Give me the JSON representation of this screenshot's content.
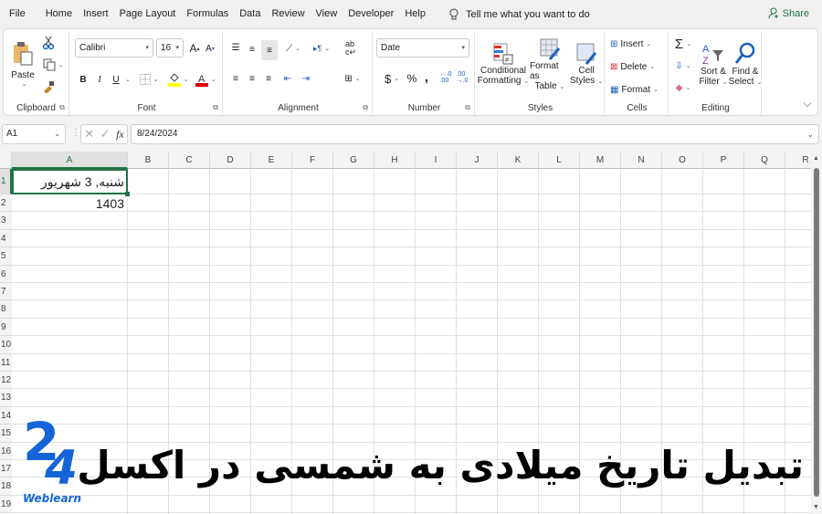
{
  "menubar": {
    "tabs": [
      "File",
      "Home",
      "Insert",
      "Page Layout",
      "Formulas",
      "Data",
      "Review",
      "View",
      "Developer",
      "Help"
    ],
    "active_tab": "Home",
    "tell_me": "Tell me what you want to do",
    "share": "Share"
  },
  "ribbon": {
    "clipboard": {
      "label": "Clipboard",
      "paste": "Paste"
    },
    "font": {
      "label": "Font",
      "name": "Calibri",
      "size": "16",
      "bold": "B",
      "italic": "I",
      "underline": "U",
      "fill_color": "#ffff00",
      "font_color": "#e00000"
    },
    "alignment": {
      "label": "Alignment"
    },
    "number": {
      "label": "Number",
      "format": "Date",
      "currency": "$",
      "percent": "%",
      "comma": ","
    },
    "styles": {
      "label": "Styles",
      "conditional": [
        "Conditional",
        "Formatting"
      ],
      "format_table": [
        "Format as",
        "Table"
      ],
      "cell_styles": [
        "Cell",
        "Styles"
      ]
    },
    "cells": {
      "label": "Cells",
      "insert": "Insert",
      "delete": "Delete",
      "format": "Format"
    },
    "editing": {
      "label": "Editing",
      "sort": [
        "Sort &",
        "Filter"
      ],
      "find": [
        "Find &",
        "Select"
      ]
    }
  },
  "formula_bar": {
    "name_box": "A1",
    "value": "8/24/2024",
    "fx": "fx"
  },
  "sheet": {
    "columns": [
      "A",
      "B",
      "C",
      "D",
      "E",
      "F",
      "G",
      "H",
      "I",
      "J",
      "K",
      "L",
      "M",
      "N",
      "O",
      "P",
      "Q",
      "R"
    ],
    "rows": [
      "1",
      "2",
      "3",
      "4",
      "5",
      "6",
      "7",
      "8",
      "9",
      "10",
      "11",
      "12",
      "13",
      "14",
      "15",
      "16",
      "17",
      "18",
      "19"
    ],
    "a1_display": "شنبه, 3 شهریور 1403",
    "accent": "#217346"
  },
  "overlay": {
    "logo_number": "24",
    "logo_text": "Weblearn",
    "logo_color": "#1565d8",
    "title": "تبدیل تاریخ میلادی به شمسی در اکسل"
  }
}
